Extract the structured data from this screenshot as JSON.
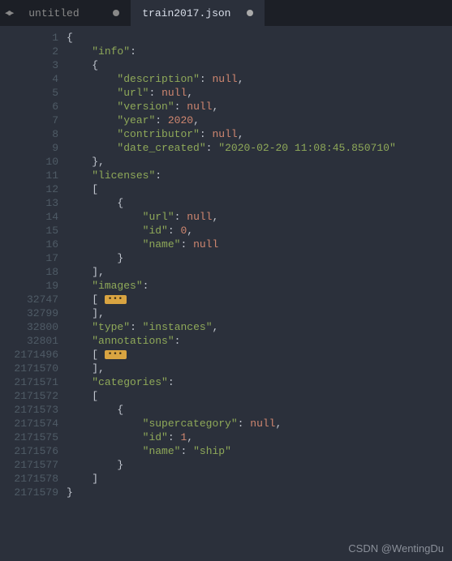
{
  "tabs": [
    {
      "label": "untitled",
      "active": false,
      "dirty": true
    },
    {
      "label": "train2017.json",
      "active": true,
      "dirty": true
    }
  ],
  "nav": {
    "back": "◀",
    "fwd": "▶"
  },
  "fold_marker": "•••",
  "gutter": [
    "1",
    "2",
    "3",
    "4",
    "5",
    "6",
    "7",
    "8",
    "9",
    "10",
    "11",
    "12",
    "13",
    "14",
    "15",
    "16",
    "17",
    "18",
    "19",
    "32747",
    "32799",
    "32800",
    "32801",
    "2171496",
    "2171570",
    "2171571",
    "2171572",
    "2171573",
    "2171574",
    "2171575",
    "2171576",
    "2171577",
    "2171578",
    "2171579"
  ],
  "code": {
    "info": {
      "key": "info",
      "description": {
        "k": "description",
        "v": "null",
        "trail": ","
      },
      "url": {
        "k": "url",
        "v": "null",
        "trail": ","
      },
      "version": {
        "k": "version",
        "v": "null",
        "trail": ","
      },
      "year": {
        "k": "year",
        "v": "2020",
        "trail": ","
      },
      "contributor": {
        "k": "contributor",
        "v": "null",
        "trail": ","
      },
      "date_created": {
        "k": "date_created",
        "v": "2020-02-20 11:08:45.850710",
        "is_string": true
      }
    },
    "licenses": {
      "key": "licenses",
      "item": {
        "url": {
          "k": "url",
          "v": "null",
          "trail": ","
        },
        "id": {
          "k": "id",
          "v": "0",
          "trail": ","
        },
        "name": {
          "k": "name",
          "v": "null"
        }
      }
    },
    "images": {
      "key": "images"
    },
    "type": {
      "k": "type",
      "v": "instances",
      "is_string": true,
      "trail": ","
    },
    "annotations": {
      "key": "annotations"
    },
    "categories": {
      "key": "categories",
      "item": {
        "supercategory": {
          "k": "supercategory",
          "v": "null",
          "trail": ","
        },
        "id": {
          "k": "id",
          "v": "1",
          "trail": ","
        },
        "name": {
          "k": "name",
          "v": "ship",
          "is_string": true
        }
      }
    }
  },
  "watermark": "CSDN @WentingDu"
}
